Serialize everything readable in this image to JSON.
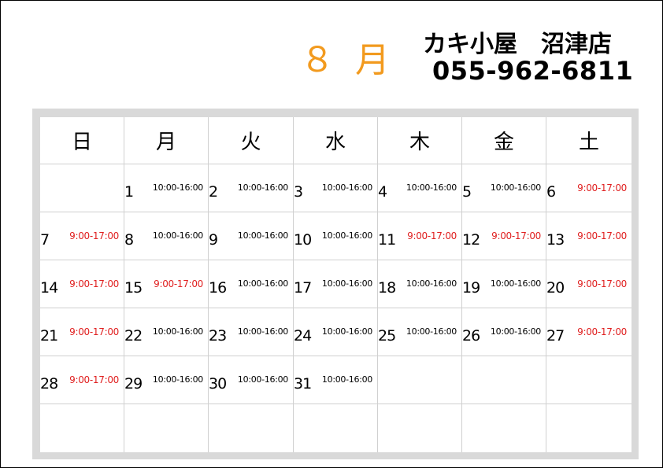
{
  "header": {
    "month": "８ 月",
    "shop_name": "カキ小屋　沼津店",
    "phone": "055-962-6811"
  },
  "colors": {
    "month": "#f29a1e",
    "weekend_hours": "#e02020",
    "frame": "#d9d9d9",
    "grid_line": "#d0d0d0"
  },
  "weekdays": [
    "日",
    "月",
    "火",
    "水",
    "木",
    "金",
    "土"
  ],
  "weeks": [
    [
      {
        "day": "",
        "hours": "",
        "weekend": false
      },
      {
        "day": "1",
        "hours": "10:00-16:00",
        "weekend": false
      },
      {
        "day": "2",
        "hours": "10:00-16:00",
        "weekend": false
      },
      {
        "day": "3",
        "hours": "10:00-16:00",
        "weekend": false
      },
      {
        "day": "4",
        "hours": "10:00-16:00",
        "weekend": false
      },
      {
        "day": "5",
        "hours": "10:00-16:00",
        "weekend": false
      },
      {
        "day": "6",
        "hours": "9:00-17:00",
        "weekend": true
      }
    ],
    [
      {
        "day": "7",
        "hours": "9:00-17:00",
        "weekend": true
      },
      {
        "day": "8",
        "hours": "10:00-16:00",
        "weekend": false
      },
      {
        "day": "9",
        "hours": "10:00-16:00",
        "weekend": false
      },
      {
        "day": "10",
        "hours": "10:00-16:00",
        "weekend": false
      },
      {
        "day": "11",
        "hours": "9:00-17:00",
        "weekend": true
      },
      {
        "day": "12",
        "hours": "9:00-17:00",
        "weekend": true
      },
      {
        "day": "13",
        "hours": "9:00-17:00",
        "weekend": true
      }
    ],
    [
      {
        "day": "14",
        "hours": "9:00-17:00",
        "weekend": true
      },
      {
        "day": "15",
        "hours": "9:00-17:00",
        "weekend": true
      },
      {
        "day": "16",
        "hours": "10:00-16:00",
        "weekend": false
      },
      {
        "day": "17",
        "hours": "10:00-16:00",
        "weekend": false
      },
      {
        "day": "18",
        "hours": "10:00-16:00",
        "weekend": false
      },
      {
        "day": "19",
        "hours": "10:00-16:00",
        "weekend": false
      },
      {
        "day": "20",
        "hours": "9:00-17:00",
        "weekend": true
      }
    ],
    [
      {
        "day": "21",
        "hours": "9:00-17:00",
        "weekend": true
      },
      {
        "day": "22",
        "hours": "10:00-16:00",
        "weekend": false
      },
      {
        "day": "23",
        "hours": "10:00-16:00",
        "weekend": false
      },
      {
        "day": "24",
        "hours": "10:00-16:00",
        "weekend": false
      },
      {
        "day": "25",
        "hours": "10:00-16:00",
        "weekend": false
      },
      {
        "day": "26",
        "hours": "10:00-16:00",
        "weekend": false
      },
      {
        "day": "27",
        "hours": "9:00-17:00",
        "weekend": true
      }
    ],
    [
      {
        "day": "28",
        "hours": "9:00-17:00",
        "weekend": true
      },
      {
        "day": "29",
        "hours": "10:00-16:00",
        "weekend": false
      },
      {
        "day": "30",
        "hours": "10:00-16:00",
        "weekend": false
      },
      {
        "day": "31",
        "hours": "10:00-16:00",
        "weekend": false
      },
      {
        "day": "",
        "hours": "",
        "weekend": false
      },
      {
        "day": "",
        "hours": "",
        "weekend": false
      },
      {
        "day": "",
        "hours": "",
        "weekend": false
      }
    ],
    [
      {
        "day": "",
        "hours": "",
        "weekend": false
      },
      {
        "day": "",
        "hours": "",
        "weekend": false
      },
      {
        "day": "",
        "hours": "",
        "weekend": false
      },
      {
        "day": "",
        "hours": "",
        "weekend": false
      },
      {
        "day": "",
        "hours": "",
        "weekend": false
      },
      {
        "day": "",
        "hours": "",
        "weekend": false
      },
      {
        "day": "",
        "hours": "",
        "weekend": false
      }
    ]
  ]
}
